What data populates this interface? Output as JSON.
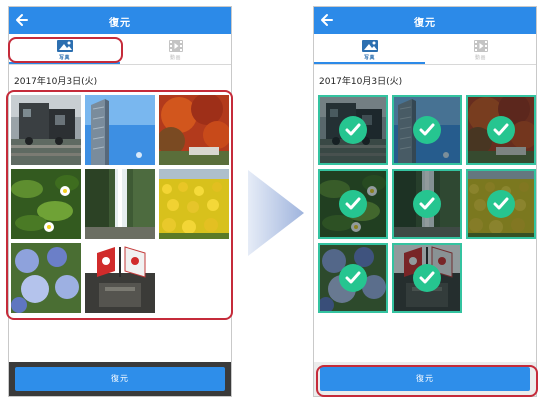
{
  "app": {
    "title": "復元",
    "tab_photo": "写真",
    "tab_video": "動画",
    "date": "2017年10月3日(火)",
    "restore_label": "復元"
  },
  "colors": {
    "appbar": "#2c8ae8",
    "button": "#2e8eea",
    "highlight": "#c52b3a",
    "check": "#26c590",
    "select_border": "#34c3a0"
  },
  "photos": [
    {
      "subject": "train"
    },
    {
      "subject": "building-sky"
    },
    {
      "subject": "autumn-leaves"
    },
    {
      "subject": "flowers-leaves"
    },
    {
      "subject": "waterfall"
    },
    {
      "subject": "yellow-flowers"
    },
    {
      "subject": "hydrangea"
    },
    {
      "subject": "flags"
    }
  ],
  "selected_count": 8,
  "icons": {
    "back": "arrow-left-icon",
    "photo": "photo-icon",
    "video": "film-icon",
    "check": "check-icon",
    "transition": "triangle-arrow-icon"
  }
}
